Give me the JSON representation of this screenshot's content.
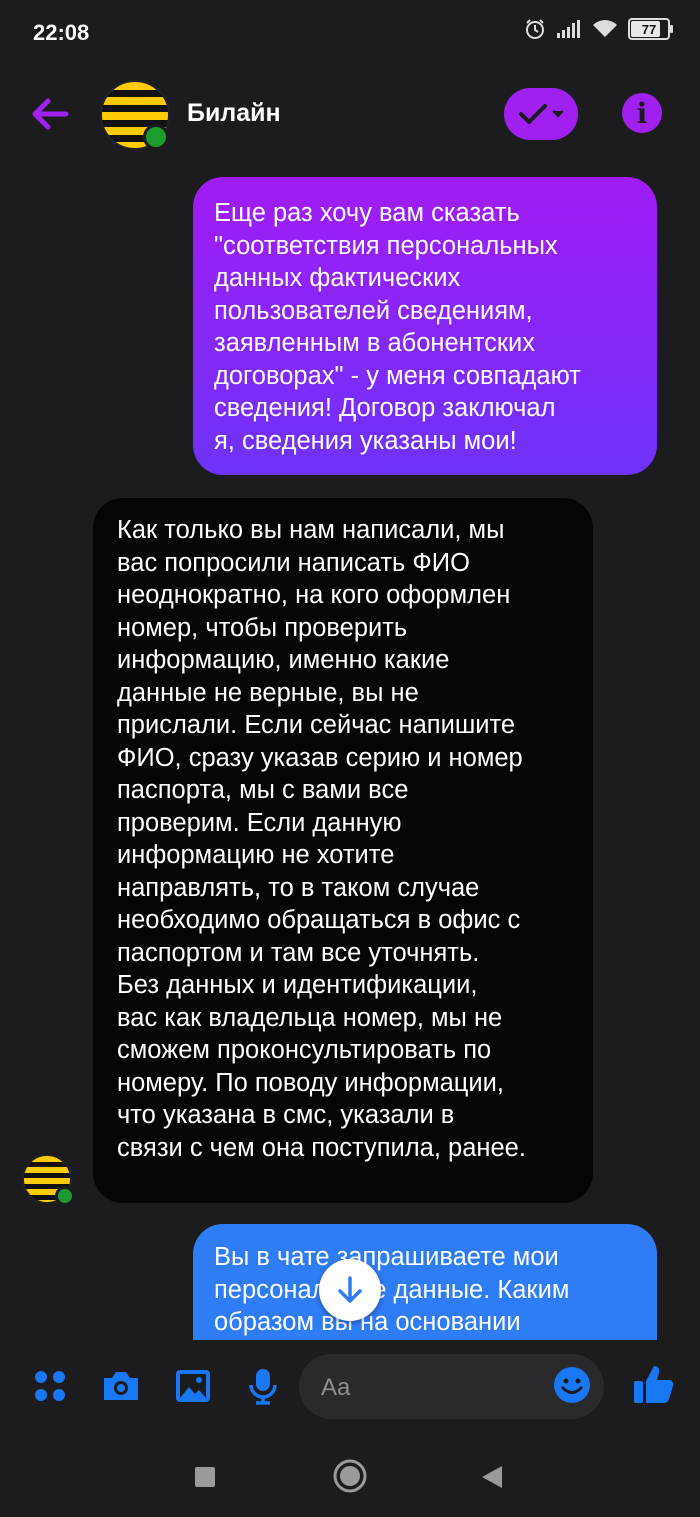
{
  "status_bar": {
    "time": "22:08",
    "battery": "77"
  },
  "header": {
    "contact_name": "Билайн"
  },
  "messages": [
    {
      "sender": "me",
      "text": "Еще раз хочу вам сказать\n\"соответствия персональных\nданных фактических\nпользователей сведениям,\nзаявленным в абонентских\nдоговорах\" - у меня совпадают\nсведения! Договор заключал\nя, сведения указаны мои!"
    },
    {
      "sender": "contact",
      "text": "Как только вы нам написали, мы\nвас попросили написать ФИО\nнеоднократно, на кого оформлен\nномер, чтобы проверить\nинформацию, именно какие\nданные не верные, вы не\nприслали. Если сейчас напишите\nФИО, сразу указав серию и номер\nпаспорта, мы с вами все\nпроверим. Если данную\nинформацию не хотите\nнаправлять, то в таком случае\nнеобходимо обращаться в офис с\nпаспортом и там все уточнять.\nБез данных и идентификации,\nвас как владельца номер, мы не\nсможем проконсультировать по\nномеру.  По поводу информации,\nчто указана в смс, указали в\nсвязи с чем она поступила, ранее."
    },
    {
      "sender": "me",
      "text": "Вы в чате запрашиваете мои\nперсональные данные. Каким\nобразом вы на основании"
    }
  ],
  "composer": {
    "placeholder": "Aa"
  },
  "colors": {
    "accent_purple": "#a020f0",
    "accent_blue": "#1877f2",
    "bubble_blue": "#2f7df6"
  },
  "icons": [
    "back-arrow-icon",
    "check-icon",
    "info-icon",
    "apps-icon",
    "camera-icon",
    "gallery-icon",
    "microphone-icon",
    "emoji-icon",
    "thumbs-up-icon",
    "arrow-down-icon",
    "square-nav-icon",
    "home-nav-icon",
    "back-nav-icon"
  ]
}
